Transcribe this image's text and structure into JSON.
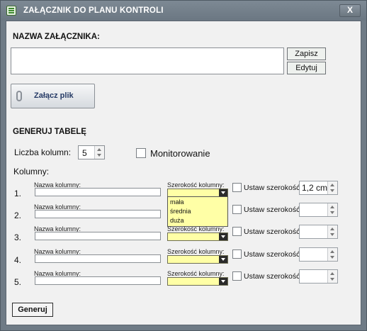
{
  "window": {
    "title": "ZAŁĄCZNIK DO PLANU KONTROLI",
    "close_label": "X"
  },
  "attachment": {
    "name_label": "NAZWA ZAŁĄCZNIKA:",
    "name_value": "",
    "save_label": "Zapisz",
    "edit_label": "Edytuj",
    "attach_label": "Załącz plik"
  },
  "table_gen": {
    "title": "GENERUJ TABELĘ",
    "column_count_label": "Liczba kolumn:",
    "column_count_value": "5",
    "monitor_label": "Monitorowanie",
    "monitor_checked": false,
    "columns_label": "Kolumny:",
    "column_name_label": "Nazwa kolumny:",
    "column_width_label": "Szerokość kolumny:",
    "set_width_label": "Ustaw szerokość:",
    "rows": [
      {
        "num": "1.",
        "name": "",
        "width_value": "1,2 cm"
      },
      {
        "num": "2.",
        "name": "",
        "width_value": ""
      },
      {
        "num": "3.",
        "name": "",
        "width_value": ""
      },
      {
        "num": "4.",
        "name": "",
        "width_value": ""
      },
      {
        "num": "5.",
        "name": "",
        "width_value": ""
      }
    ],
    "width_options": [
      "mała",
      "średnia",
      "duża"
    ],
    "generate_label": "Generuj"
  }
}
